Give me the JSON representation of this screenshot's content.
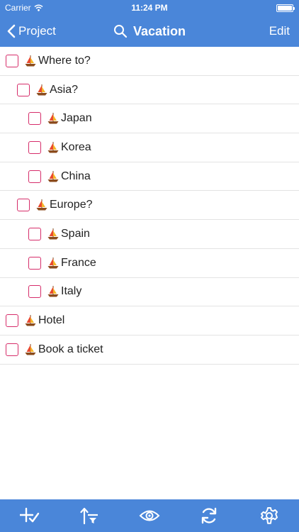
{
  "status_bar": {
    "carrier": "Carrier",
    "time": "11:24 PM"
  },
  "nav": {
    "back_label": "Project",
    "title": "Vacation",
    "edit_label": "Edit"
  },
  "tasks": [
    {
      "label": "Where to?",
      "level": 0,
      "checked": false,
      "icon": "sailboat-icon"
    },
    {
      "label": "Asia?",
      "level": 1,
      "checked": false,
      "icon": "sailboat-icon"
    },
    {
      "label": "Japan",
      "level": 2,
      "checked": false,
      "icon": "sailboat-icon"
    },
    {
      "label": "Korea",
      "level": 2,
      "checked": false,
      "icon": "sailboat-icon"
    },
    {
      "label": "China",
      "level": 2,
      "checked": false,
      "icon": "sailboat-icon"
    },
    {
      "label": "Europe?",
      "level": 1,
      "checked": false,
      "icon": "sailboat-icon"
    },
    {
      "label": "Spain",
      "level": 2,
      "checked": false,
      "icon": "sailboat-icon"
    },
    {
      "label": "France",
      "level": 2,
      "checked": false,
      "icon": "sailboat-icon"
    },
    {
      "label": "Italy",
      "level": 2,
      "checked": false,
      "icon": "sailboat-icon"
    },
    {
      "label": "Hotel",
      "level": 0,
      "checked": false,
      "icon": "sailboat-icon"
    },
    {
      "label": "Book a ticket",
      "level": 0,
      "checked": false,
      "icon": "sailboat-icon"
    }
  ],
  "toolbar": {
    "buttons": [
      "add-check-icon",
      "sort-filter-icon",
      "eye-icon",
      "sync-icon",
      "gear-icon"
    ]
  },
  "colors": {
    "bar_background": "#4a86d9",
    "checkbox_border": "#d62d6a",
    "separator": "#e3e3e3"
  }
}
